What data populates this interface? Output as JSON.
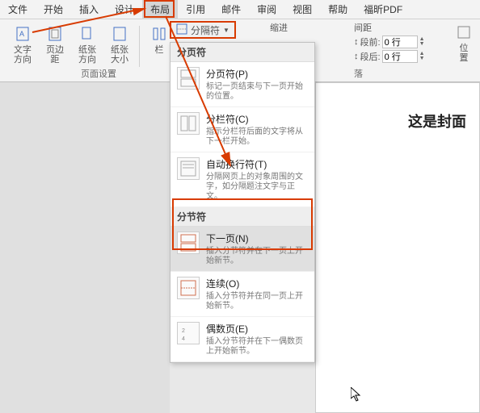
{
  "menu": {
    "file": "文件",
    "home": "开始",
    "insert": "插入",
    "design": "设计",
    "layout": "布局",
    "ref": "引用",
    "mail": "邮件",
    "review": "审阅",
    "view": "视图",
    "help": "帮助",
    "pdf": "福昕PDF"
  },
  "ribbon": {
    "textdir": "文字方向",
    "margin": "页边距",
    "orient": "纸张方向",
    "size": "纸张大小",
    "columns": "栏",
    "breaks": "分隔符",
    "indent": "缩进",
    "spacing": "间距",
    "before": "段前:",
    "after": "段后:",
    "zero": "0 行",
    "pagesetup": "页面设置",
    "paragraph": "落",
    "position": "位置"
  },
  "popup": {
    "h1": "分页符",
    "i1t": "分页符(P)",
    "i1d": "标记一页结束与下一页开始的位置。",
    "i2t": "分栏符(C)",
    "i2d": "指示分栏符后面的文字将从下一栏开始。",
    "i3t": "自动换行符(T)",
    "i3d": "分隔网页上的对象周围的文字，如分隔题注文字与正文。",
    "h2": "分节符",
    "i4t": "下一页(N)",
    "i4d": "插入分节符并在下一页上开始新节。",
    "i5t": "连续(O)",
    "i5d": "插入分节符并在同一页上开始新节。",
    "i6t": "偶数页(E)",
    "i6d": "插入分节符并在下一偶数页上开始新节。"
  },
  "doc": {
    "title": "这是封面"
  }
}
